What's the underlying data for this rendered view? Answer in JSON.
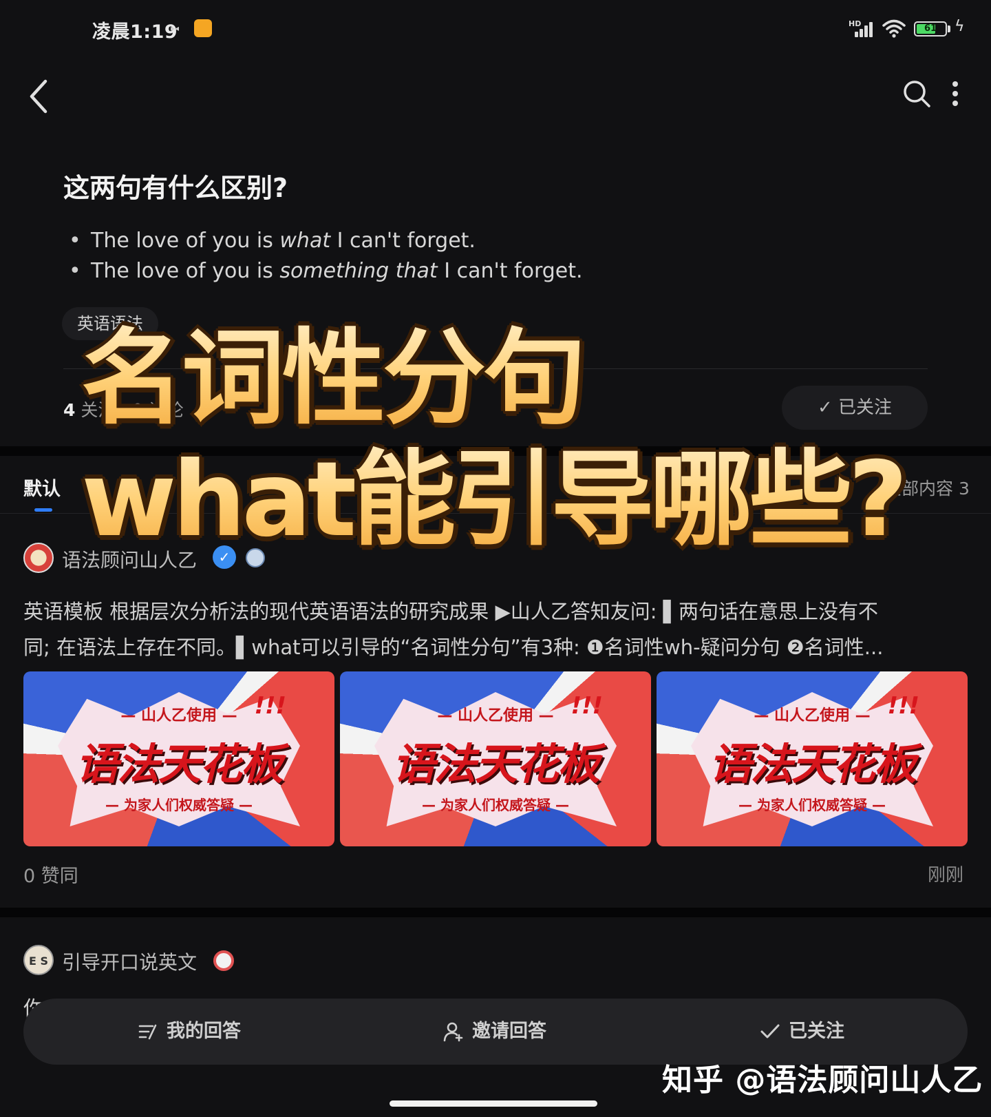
{
  "status_bar": {
    "time": "凌晨1:19",
    "network_badge": "HD",
    "battery_level": "61",
    "accent_color": "#f5a623"
  },
  "nav": {
    "back_icon": "chevron-left-icon",
    "search_icon": "search-icon",
    "more_icon": "more-vertical-icon"
  },
  "question": {
    "title": "这两句有什么区别?",
    "bullet_1_pre": "The love of you is ",
    "bullet_1_em": "what",
    "bullet_1_post": " I can't forget.",
    "bullet_2_pre": "The love of you is ",
    "bullet_2_em": "something that",
    "bullet_2_post": " I can't forget.",
    "topic_tag": "英语语法",
    "follow_num": "4",
    "follow_label": "关注",
    "comment_num": "0",
    "comment_label": "评论",
    "follow_button": "已关注"
  },
  "overlay": {
    "line1": "名词性分句",
    "line2": "what能引导哪些?"
  },
  "tabs": {
    "default_tab": "默认",
    "all_content": "全部内容 3",
    "accent_color": "#2f7df6"
  },
  "answer_1": {
    "author": "语法顾问山人乙",
    "excerpt_line1": "英语模板 根据层次分析法的现代英语语法的研究成果 ▶山人乙答知友问: ▌两句话在意思上没有不",
    "excerpt_line2": "同; 在语法上存在不同。▌what可以引导的“名词性分句”有3种: ❶名词性wh-疑问分句 ❷名词性...",
    "thumbnails": [
      {
        "top": "— 山人乙使用 —",
        "main": "语法天花板",
        "sub": "— 为家人们权威答疑 —",
        "excl": "!!!"
      },
      {
        "top": "— 山人乙使用 —",
        "main": "语法天花板",
        "sub": "— 为家人们权威答疑 —",
        "excl": "!!!"
      },
      {
        "top": "— 山人乙使用 —",
        "main": "语法天花板",
        "sub": "— 为家人们权威答疑 —",
        "excl": "!!!"
      }
    ],
    "likes": "0 赞同",
    "time": "刚刚"
  },
  "answer_2": {
    "author": "引导开口说英文",
    "avatar_text": "E S",
    "excerpt_start": "你"
  },
  "action_bar": {
    "my_answer": "我的回答",
    "invite": "邀请回答",
    "followed": "已关注"
  },
  "watermark": "知乎 @语法顾问山人乙"
}
